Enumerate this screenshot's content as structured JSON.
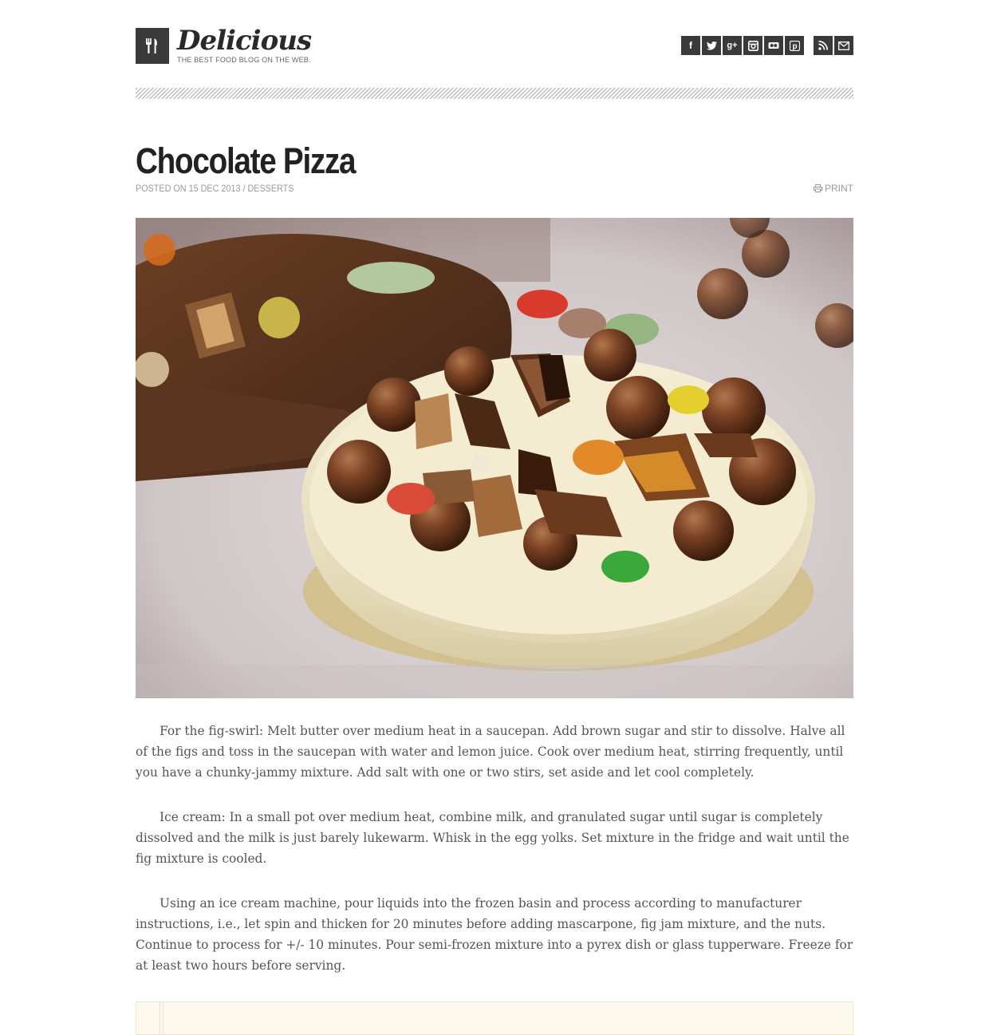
{
  "site": {
    "title": "Delicious",
    "tagline": "THE BEST FOOD BLOG ON THE WEB."
  },
  "social": [
    {
      "icon": "facebook-icon",
      "glyph": "f"
    },
    {
      "icon": "twitter-icon",
      "glyph": "t"
    },
    {
      "icon": "google-plus-icon",
      "glyph": "g+"
    },
    {
      "icon": "instagram-icon",
      "glyph": "◙"
    },
    {
      "icon": "flickr-icon",
      "glyph": "●●"
    },
    {
      "icon": "pinterest-icon",
      "glyph": "p"
    },
    {
      "icon": "rss-icon",
      "glyph": "◥"
    },
    {
      "icon": "email-icon",
      "glyph": "✉"
    }
  ],
  "post": {
    "title": "Chocolate Pizza",
    "meta": "POSTED ON 15 DEC 2013 / DESSERTS",
    "print_label": "PRINT",
    "paragraphs": [
      "For the fig-swirl: Melt butter over medium heat in a saucepan. Add brown sugar and stir to dissolve. Halve all of the figs and toss in the saucepan with water and lemon juice. Cook over medium heat, stirring frequently, until you have a chunky-jammy mixture. Add salt with one or two stirs, set aside and let cool completely.",
      "Ice cream: In a small pot over medium heat, combine milk, and granulated sugar until sugar is completely dissolved and the milk is just barely lukewarm. Whisk in the egg yolks. Set mixture in the fridge and wait until the fig mixture is cooled.",
      "Using an ice cream machine, pour liquids into the frozen basin and process according to manufacturer instructions, i.e., let spin and thicken for 20 minutes before adding mascarpone, fig jam mixture, and the nuts. Continue to process for +/- 10 minutes. Pour semi-frozen mixture into a pyrex dish or glass tupperware. Freeze for at least two hours before serving."
    ]
  },
  "colors": {
    "icon_bg": "#3a3a3a",
    "text": "#555555",
    "meta": "#999999",
    "recipe_bg": "#fdf9ec"
  }
}
